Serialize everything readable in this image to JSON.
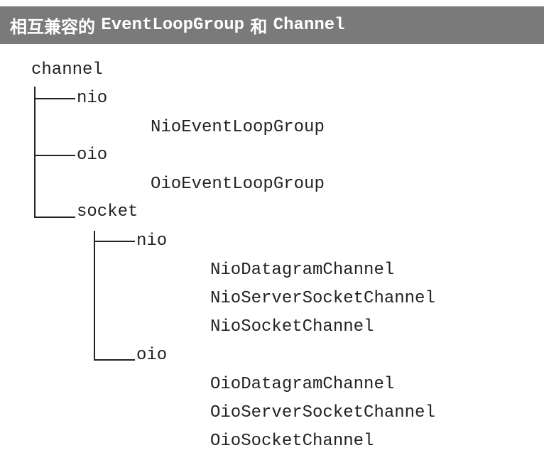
{
  "header": {
    "title_prefix": "相互兼容的 ",
    "title_mono_1": "EventLoopGroup",
    "title_middle": " 和 ",
    "title_mono_2": "Channel"
  },
  "tree": {
    "root": "channel",
    "nio": "nio",
    "nio_group": "NioEventLoopGroup",
    "oio": "oio",
    "oio_group": "OioEventLoopGroup",
    "socket": "socket",
    "socket_nio": "nio",
    "nio_datagram": "NioDatagramChannel",
    "nio_server_socket": "NioServerSocketChannel",
    "nio_socket": "NioSocketChannel",
    "socket_oio": "oio",
    "oio_datagram": "OioDatagramChannel",
    "oio_server_socket": "OioServerSocketChannel",
    "oio_socket": "OioSocketChannel"
  }
}
